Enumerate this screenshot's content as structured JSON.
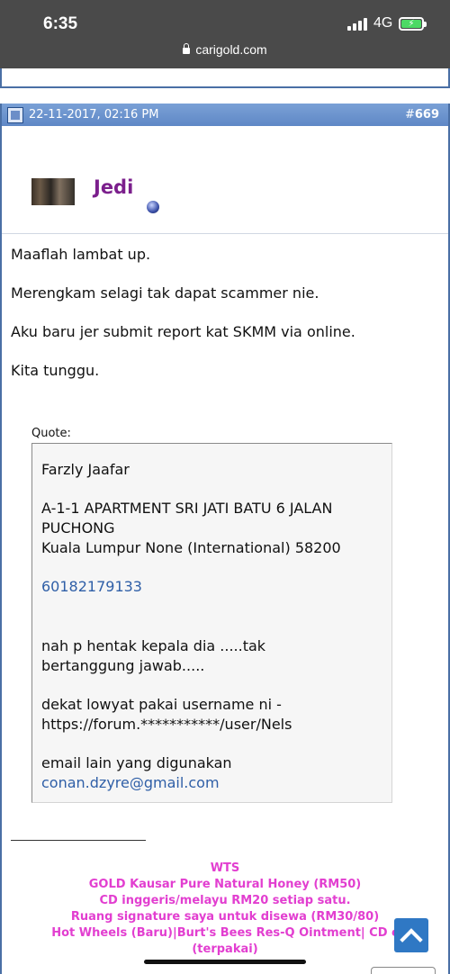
{
  "status_bar": {
    "time": "6:35",
    "network": "4G",
    "battery_level": 1.0,
    "url": "carigold.com"
  },
  "post": {
    "date": "22-11-2017, 02:16 PM",
    "number_prefix": "#",
    "number": "669",
    "username": "Jedi",
    "lines": [
      "Maaflah lambat up.",
      "Merengkam selagi tak dapat scammer nie.",
      "Aku baru jer submit report kat SKMM via online.",
      "Kita tunggu."
    ],
    "quote_label": "Quote:",
    "quote": {
      "name": "Farzly Jaafar",
      "address_1": "A-1-1 APARTMENT SRI JATI BATU 6 JALAN",
      "address_2": "PUCHONG",
      "address_3": "Kuala Lumpur None (International) 58200",
      "phone": "60182179133",
      "comment_1": "nah p hentak kepala dia .....tak",
      "comment_2": "bertanggung jawab.....",
      "comment_3": "dekat lowyat pakai username ni -",
      "comment_4": "https://forum.***********/user/Nels",
      "comment_5": "email lain yang digunakan",
      "email": "conan.dzyre@gmail.com"
    },
    "signature": [
      "WTS",
      "GOLD Kausar Pure Natural Honey (RM50)",
      "CD inggeris/melayu RM20 setiap satu.",
      "Ruang signature saya untuk disewa (RM30/80)",
      "Hot Wheels (Baru)|Burt's Bees Res-Q Ointment| CD c",
      "(terpakai)"
    ]
  },
  "colors": {
    "header_blue": "#5f88c6",
    "username_purple": "#7b1f8c",
    "signature_pink": "#e23ed0",
    "link_blue": "#2f5fa7",
    "scroll_button": "#2f78c4"
  }
}
